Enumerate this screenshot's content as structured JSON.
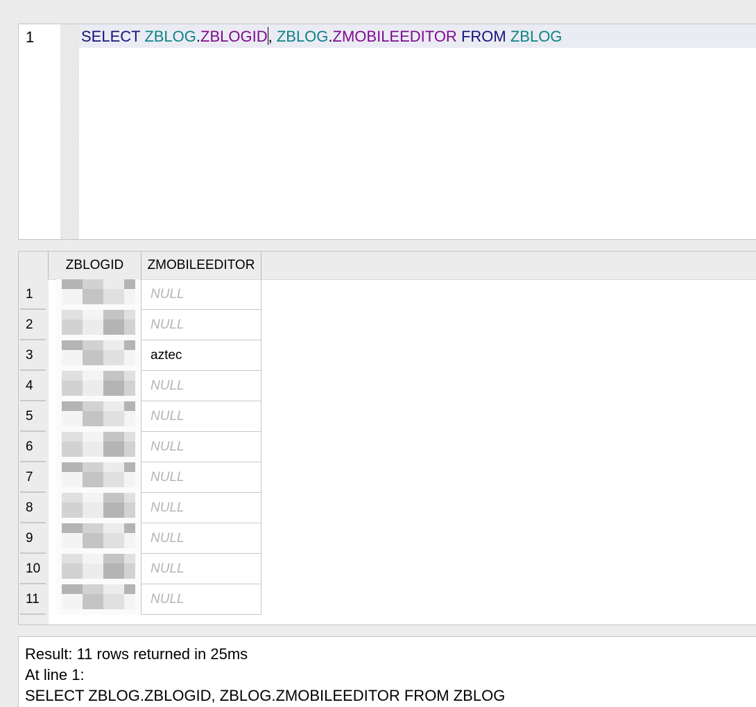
{
  "editor": {
    "line_number": "1",
    "sql_tokens": [
      {
        "text": "SELECT",
        "kind": "kw"
      },
      {
        "text": " ",
        "kind": "pun"
      },
      {
        "text": "ZBLOG",
        "kind": "tbl"
      },
      {
        "text": ".",
        "kind": "pun"
      },
      {
        "text": "ZBLOGID",
        "kind": "col"
      },
      {
        "text": "|",
        "kind": "caret"
      },
      {
        "text": ", ",
        "kind": "pun"
      },
      {
        "text": "ZBLOG",
        "kind": "tbl"
      },
      {
        "text": ".",
        "kind": "pun"
      },
      {
        "text": "ZMOBILEEDITOR",
        "kind": "col"
      },
      {
        "text": " ",
        "kind": "pun"
      },
      {
        "text": "FROM",
        "kind": "kw"
      },
      {
        "text": " ",
        "kind": "pun"
      },
      {
        "text": "ZBLOG",
        "kind": "tbl"
      }
    ]
  },
  "results": {
    "columns": [
      "ZBLOGID",
      "ZMOBILEEDITOR"
    ],
    "rows": [
      {
        "num": "1",
        "editor": "NULL"
      },
      {
        "num": "2",
        "editor": "NULL"
      },
      {
        "num": "3",
        "editor": "aztec"
      },
      {
        "num": "4",
        "editor": "NULL"
      },
      {
        "num": "5",
        "editor": "NULL"
      },
      {
        "num": "6",
        "editor": "NULL"
      },
      {
        "num": "7",
        "editor": "NULL"
      },
      {
        "num": "8",
        "editor": "NULL"
      },
      {
        "num": "9",
        "editor": "NULL"
      },
      {
        "num": "10",
        "editor": "NULL"
      },
      {
        "num": "11",
        "editor": "NULL"
      }
    ],
    "null_color": "#b4b4b4"
  },
  "messages": {
    "result_line": "Result: 11 rows returned in 25ms",
    "at_line": "At line 1:",
    "query": "SELECT ZBLOG.ZBLOGID, ZBLOG.ZMOBILEEDITOR FROM ZBLOG"
  },
  "colors": {
    "keyword": "#14147a",
    "table": "#0b8484",
    "column": "#7e0b8e",
    "current_line": "#ebebf4"
  }
}
